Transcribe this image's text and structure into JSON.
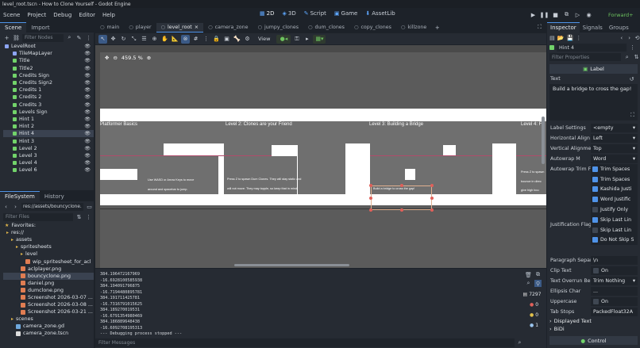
{
  "window": {
    "title": "level_root.tscn - How to Clone Yourself - Godot Engine"
  },
  "menus": [
    "Scene",
    "Project",
    "Debug",
    "Editor",
    "Help"
  ],
  "workspaces": [
    "2D",
    "3D",
    "Script",
    "Game",
    "AssetLib"
  ],
  "renderer": "Forward+",
  "scene_dock": {
    "tabs": [
      "Scene",
      "Import"
    ],
    "filter_placeholder": "Filter Nodes",
    "nodes": [
      "LevelRoot",
      "TileMapLayer",
      "Title",
      "Title2",
      "Credits Sign",
      "Credits Sign2",
      "Credits 1",
      "Credits 2",
      "Credits 3",
      "Levels Sign",
      "Hint 1",
      "Hint 2",
      "Hint 4",
      "Hint 3",
      "Level 2",
      "Level 3",
      "Level 4",
      "Level 6"
    ],
    "selected": "Hint 4"
  },
  "filesystem": {
    "tabs": [
      "FileSystem",
      "History"
    ],
    "path": "res://assets/bouncyclone.",
    "filter_placeholder": "Filter Files",
    "items": [
      {
        "label": "Favorites:",
        "type": "fav"
      },
      {
        "label": "res://",
        "type": "folder"
      },
      {
        "label": "assets",
        "type": "folder"
      },
      {
        "label": "spritesheets",
        "type": "folder"
      },
      {
        "label": "level",
        "type": "folder"
      },
      {
        "label": "wip_spritesheet_for_acl",
        "type": "png"
      },
      {
        "label": "aclplayer.png",
        "type": "png"
      },
      {
        "label": "bouncyclone.png",
        "type": "png"
      },
      {
        "label": "daniel.png",
        "type": "png"
      },
      {
        "label": "dumclone.png",
        "type": "png"
      },
      {
        "label": "Screenshot 2026-03-07 ...",
        "type": "png"
      },
      {
        "label": "Screenshot 2026-03-08 ...",
        "type": "png"
      },
      {
        "label": "Screenshot 2026-03-21 ...",
        "type": "png"
      },
      {
        "label": "scenes",
        "type": "folder"
      },
      {
        "label": "camera_zone.gd",
        "type": "gd"
      },
      {
        "label": "camera_zone.tscn",
        "type": "tscn"
      }
    ],
    "selected": "bouncyclone.png"
  },
  "scene_tabs": [
    "main",
    "player",
    "level_root",
    "camera_zone",
    "jumpy_clones",
    "dum_clones",
    "copy_clones",
    "killzone"
  ],
  "active_scene_tab": "level_root",
  "viewport": {
    "zoom": "459.5 %",
    "view_label": "View",
    "labels": {
      "platformer": "Platformer Basics",
      "level2": "Level 2: Clones are your Friend",
      "level3": "Level 3: Building a Bridge",
      "level4": "Level 4: F"
    },
    "hints": {
      "wasd1": "Use WASD or Arrow Keys to move",
      "wasd2": "around and spacebar to jump.",
      "q1": "Press Z to spawn Dum Clones. They will stay static and",
      "q2": "will not move. They may topple, so keep that in mind.",
      "bridge": "Build a bridge to cross the gap!",
      "r1": "Press Z to spawn",
      "r2": "bounce in direc",
      "r3": "give high bou"
    }
  },
  "console": {
    "lines": [
      "384.196472167969",
      "-16.6928100585938",
      "384.194091796875",
      "-16.7194480895781",
      "384.191711425781",
      "-16.7316791015625",
      "384.189270019531",
      "-16.6791354980469",
      "384.186889648438",
      "-16.6092708195313",
      "--- Debugging process stopped ---"
    ],
    "filter_placeholder": "Filter Messages",
    "counts": {
      "messages": "7297",
      "errors": "0",
      "warnings": "0",
      "info": "1"
    }
  },
  "inspector": {
    "tabs": [
      "Inspector",
      "Signals",
      "Groups"
    ],
    "node_name": "Hint 4",
    "filter_placeholder": "Filter Properties",
    "section": "Label",
    "text_label": "Text",
    "text_value": "Build a bridge to cross the gap!",
    "props": [
      {
        "label": "Label Settings",
        "value": "<empty"
      },
      {
        "label": "Horizontal Align",
        "value": "Left"
      },
      {
        "label": "Vertical Alignme",
        "value": "Top"
      },
      {
        "label": "Autowrap M",
        "value": "Word"
      }
    ],
    "trim_label": "Autowrap Trim Fl",
    "trim_flags": [
      {
        "label": "Trim Spaces",
        "on": true
      },
      {
        "label": "Trim Spaces",
        "on": true
      },
      {
        "label": "Kashida Justi",
        "on": true
      },
      {
        "label": "Word Justific",
        "on": true
      },
      {
        "label": "Justify Only",
        "on": false
      },
      {
        "label": "Skip Last Lin",
        "on": true
      },
      {
        "label": "Skip Last Lin",
        "on": false
      },
      {
        "label": "Do Not Skip S",
        "on": true
      }
    ],
    "just_label": "Justification Flag",
    "props2": [
      {
        "label": "Paragraph Separ",
        "value": "\\n"
      },
      {
        "label": "Clip Text",
        "value": "On"
      },
      {
        "label": "Text Overrun Be",
        "value": "Trim Nothing"
      },
      {
        "label": "Ellipsis Char",
        "value": "..."
      },
      {
        "label": "Uppercase",
        "value": "On"
      },
      {
        "label": "Tab Stops",
        "value": "PackedFloat32A"
      }
    ],
    "displayed_text": "Displayed Text",
    "bidi": "BiDi",
    "control": "Control"
  },
  "colors": {
    "accent": "#4f93e8",
    "node_green": "#72d36a",
    "folder": "#e0b64b",
    "error": "#e0605a",
    "warning": "#e0c04b",
    "platform_grey": "#6f6f6f"
  }
}
